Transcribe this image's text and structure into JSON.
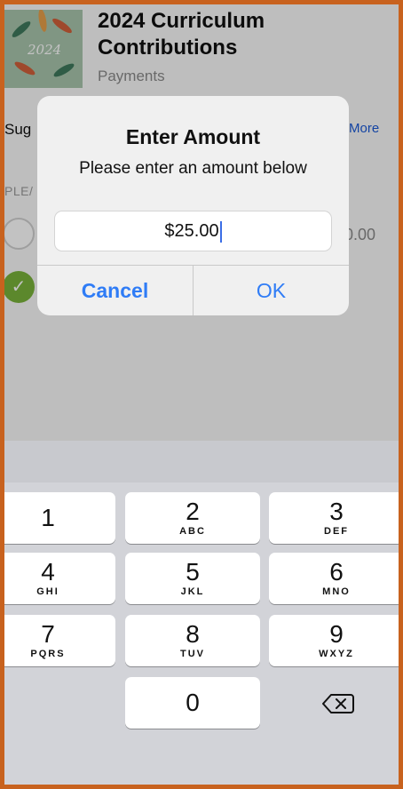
{
  "header": {
    "title": "2024 Curriculum Contributions",
    "subtitle": "Payments",
    "thumbnail_text": "2024"
  },
  "background": {
    "suggest_text": "Sug",
    "more_link": "More",
    "please_label": "PLE/",
    "amount_partial": ".0.00"
  },
  "alert": {
    "title": "Enter Amount",
    "message": "Please enter an amount below",
    "input_value": "$25.00",
    "cancel_label": "Cancel",
    "ok_label": "OK"
  },
  "keypad": {
    "keys": [
      {
        "num": "1",
        "letters": ""
      },
      {
        "num": "2",
        "letters": "ABC"
      },
      {
        "num": "3",
        "letters": "DEF"
      },
      {
        "num": "4",
        "letters": "GHI"
      },
      {
        "num": "5",
        "letters": "JKL"
      },
      {
        "num": "6",
        "letters": "MNO"
      },
      {
        "num": "7",
        "letters": "PQRS"
      },
      {
        "num": "8",
        "letters": "TUV"
      },
      {
        "num": "9",
        "letters": "WXYZ"
      },
      {
        "num": "0",
        "letters": ""
      }
    ],
    "delete_icon": "backspace-icon"
  },
  "colors": {
    "accent": "#2f7cf6",
    "check_green": "#7ab33b",
    "frame_border": "#c8621e"
  }
}
